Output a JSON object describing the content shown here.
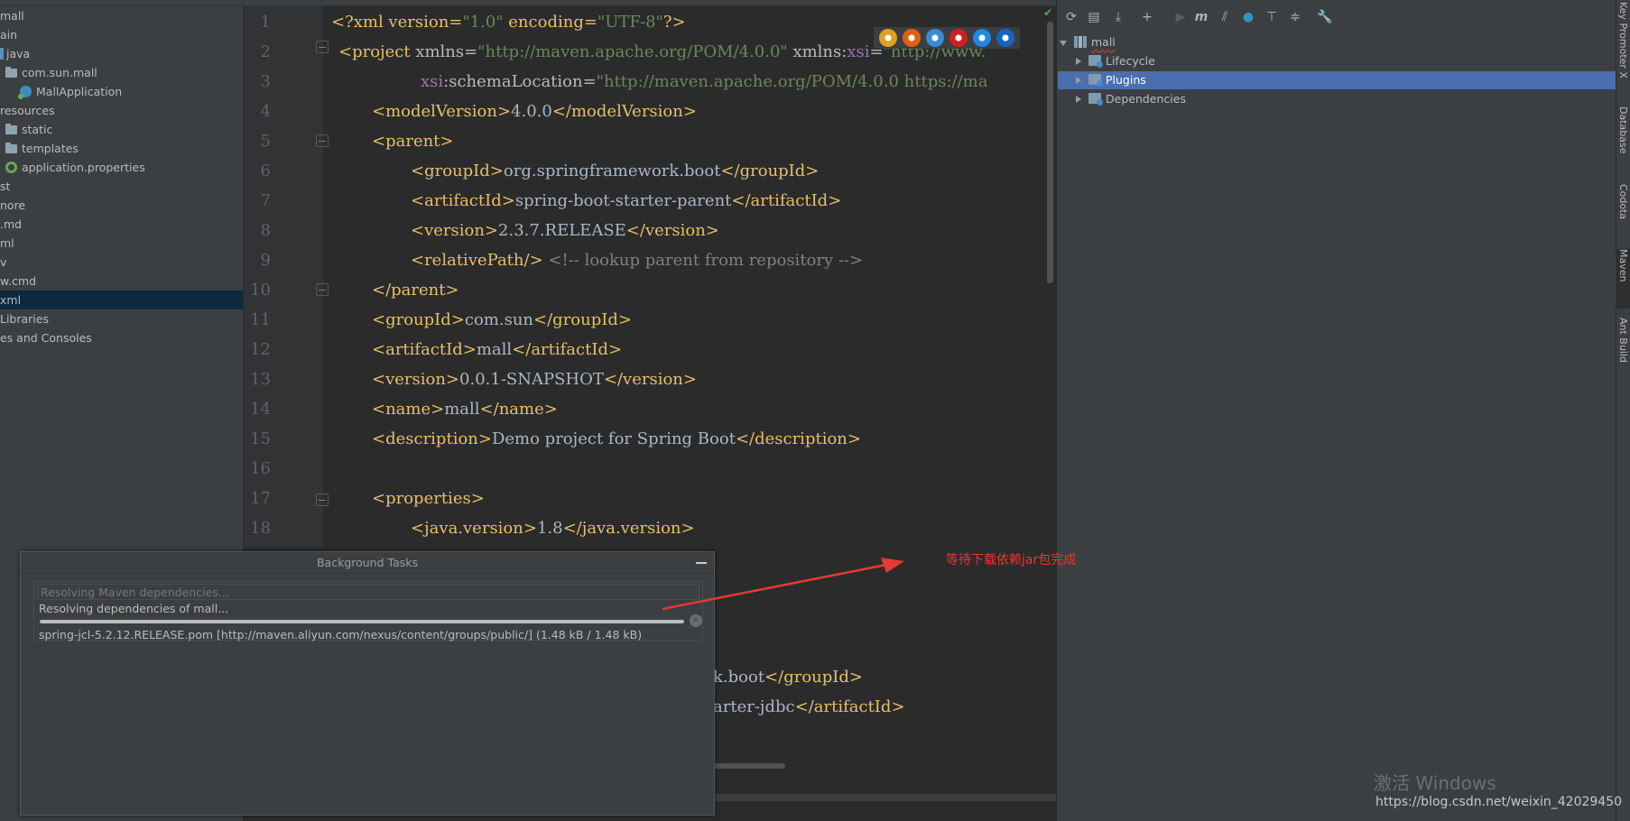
{
  "project_tree": {
    "items": [
      {
        "label": "mall",
        "kind": "text"
      },
      {
        "label": "ain",
        "kind": "text"
      },
      {
        "label": "java",
        "kind": "java"
      },
      {
        "label": "com.sun.mall",
        "kind": "folder"
      },
      {
        "label": "MallApplication",
        "kind": "class"
      },
      {
        "label": "resources",
        "kind": "text"
      },
      {
        "label": "static",
        "kind": "folder"
      },
      {
        "label": "templates",
        "kind": "folder"
      },
      {
        "label": "application.properties",
        "kind": "props"
      },
      {
        "label": "st",
        "kind": "text"
      },
      {
        "label": "nore",
        "kind": "text"
      },
      {
        "label": ".md",
        "kind": "text"
      },
      {
        "label": "ml",
        "kind": "text"
      },
      {
        "label": "v",
        "kind": "text"
      },
      {
        "label": "w.cmd",
        "kind": "text"
      },
      {
        "label": "xml",
        "kind": "text",
        "selected": true
      },
      {
        "label": "Libraries",
        "kind": "text"
      },
      {
        "label": "es and Consoles",
        "kind": "text"
      }
    ]
  },
  "editor": {
    "line_numbers": [
      "1",
      "2",
      "3",
      "4",
      "5",
      "6",
      "7",
      "8",
      "9",
      "10",
      "11",
      "12",
      "13",
      "14",
      "15",
      "16",
      "17",
      "18"
    ],
    "lines": {
      "l1": {
        "decl_open": "<?xml version=",
        "v1": "\"1.0\"",
        "enc": " encoding=",
        "v2": "\"UTF-8\"",
        "decl_close": "?>"
      },
      "l2": {
        "tag": "<project",
        "attr": " xmlns=",
        "val": "\"http://maven.apache.org/POM/4.0.0\"",
        "attr2": " xmlns:",
        "ns": "xsi",
        "eq": "=",
        "val2": "\"http://www."
      },
      "l3": {
        "ns": "xsi",
        "attr": ":schemaLocation=",
        "val": "\"http://maven.apache.org/POM/4.0.0 https://ma"
      },
      "l4": {
        "open": "<modelVersion>",
        "text": "4.0.0",
        "close": "</modelVersion>"
      },
      "l5": {
        "open": "<parent>"
      },
      "l6": {
        "open": "<groupId>",
        "text": "org.springframework.boot",
        "close": "</groupId>"
      },
      "l7": {
        "open": "<artifactId>",
        "text": "spring-boot-starter-parent",
        "close": "</artifactId>"
      },
      "l8": {
        "open": "<version>",
        "text": "2.3.7.RELEASE",
        "close": "</version>"
      },
      "l9": {
        "open": "<relativePath/>",
        "comment": " <!-- lookup parent from repository -->"
      },
      "l10": {
        "close": "</parent>"
      },
      "l11": {
        "open": "<groupId>",
        "text": "com.sun",
        "close": "</groupId>"
      },
      "l12": {
        "open": "<artifactId>",
        "text": "mall",
        "close": "</artifactId>"
      },
      "l13": {
        "open": "<version>",
        "text": "0.0.1-SNAPSHOT",
        "close": "</version>"
      },
      "l14": {
        "open": "<name>",
        "text": "mall",
        "close": "</name>"
      },
      "l15": {
        "open": "<description>",
        "text": "Demo project for Spring Boot",
        "close": "</description>"
      },
      "l17": {
        "open": "<properties>"
      },
      "l18": {
        "open": "<java.version>",
        "text": "1.8",
        "close": "</java.version>"
      },
      "p1": {
        "text": "k.boot",
        "close": "</groupId>"
      },
      "p2": {
        "text": "arter-jdbc",
        "close": "</artifactId>"
      }
    }
  },
  "browser_icons": [
    {
      "name": "chrome-icon",
      "color": "#e0a020"
    },
    {
      "name": "firefox-icon",
      "color": "#e06010"
    },
    {
      "name": "safari-icon",
      "color": "#3c8ad8"
    },
    {
      "name": "opera-icon",
      "color": "#d02020"
    },
    {
      "name": "ie-icon",
      "color": "#1e88e5"
    },
    {
      "name": "edge-icon",
      "color": "#1565c0"
    }
  ],
  "maven": {
    "toolbar": [
      {
        "name": "reload-icon",
        "glyph": "⟳"
      },
      {
        "name": "generate-sources-icon",
        "glyph": "▤"
      },
      {
        "name": "download-icon",
        "glyph": "⤓"
      },
      {
        "name": "add-icon",
        "glyph": "+"
      },
      {
        "name": "run-icon",
        "glyph": "▶"
      },
      {
        "name": "execute-goal-icon",
        "glyph": "m"
      },
      {
        "name": "toggle-offline-icon",
        "glyph": "⫽"
      },
      {
        "name": "skip-tests-icon",
        "glyph": "●"
      },
      {
        "name": "show-dependencies-icon",
        "glyph": "⊤"
      },
      {
        "name": "collapse-all-icon",
        "glyph": "≑"
      },
      {
        "name": "settings-icon",
        "glyph": "🔧"
      }
    ],
    "root": "mall",
    "children": [
      {
        "label": "Lifecycle",
        "selected": false
      },
      {
        "label": "Plugins",
        "selected": true
      },
      {
        "label": "Dependencies",
        "selected": false
      }
    ]
  },
  "side_tabs": [
    {
      "label": "Key Promoter X",
      "active": false
    },
    {
      "label": "Database",
      "active": false
    },
    {
      "label": "Codota",
      "active": false
    },
    {
      "label": "Maven",
      "active": true
    },
    {
      "label": "Ant Build",
      "active": false
    }
  ],
  "background_tasks": {
    "title": "Background Tasks",
    "task_title": "Resolving Maven dependencies...",
    "task_subtitle": "Resolving dependencies of mall...",
    "progress": 1.0,
    "detail": "spring-jcl-5.2.12.RELEASE.pom [http://maven.aliyun.com/nexus/content/groups/public/]  (1.48 kB / 1.48 kB)"
  },
  "annotation": {
    "text": "等待下载依赖jar包完成",
    "color": "#e53935"
  },
  "watermark": {
    "windows": "激活 Windows",
    "blog": "https://blog.csdn.net/weixin_42029450"
  },
  "colors": {
    "tag": "#e8bf6a",
    "string": "#6a8759",
    "comment": "#808080",
    "selection": "#4b6eaf"
  }
}
